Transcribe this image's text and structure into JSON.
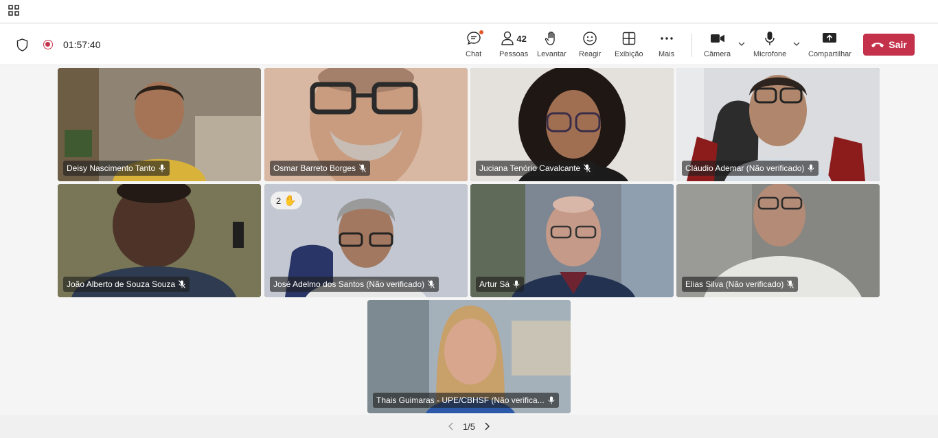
{
  "call": {
    "timer": "01:57:40"
  },
  "toolbar": {
    "chat": "Chat",
    "people": "Pessoas",
    "people_count": "42",
    "raise": "Levantar",
    "react": "Reagir",
    "view": "Exibição",
    "more": "Mais",
    "camera": "Câmera",
    "mic": "Microfone",
    "share": "Compartilhar",
    "leave": "Sair"
  },
  "participants": [
    {
      "name": "Deisy Nascimento Tanto",
      "bg": "#7a6a55"
    },
    {
      "name": "Osmar Barreto Borges",
      "bg": "#c8a792"
    },
    {
      "name": "Juciana Tenório Cavalcante",
      "bg": "#d9d4d0"
    },
    {
      "name": "Cláudio Ademar (Não verificado)",
      "bg": "#d6d8dc"
    },
    {
      "name": "João Alberto de Souza Souza",
      "bg": "#6e6a50"
    },
    {
      "name": "José Adelmo dos Santos (Não verificado)",
      "bg": "#b9bdc6",
      "hand_count": "2"
    },
    {
      "name": "Artur Sá",
      "bg": "#6f7a88"
    },
    {
      "name": "Elias Silva (Não verificado)",
      "bg": "#8a8a86"
    },
    {
      "name": "Thais Guimaras - UPE/CBHSF (Não verifica...",
      "bg": "#9aa7b2"
    }
  ],
  "pager": {
    "label": "1/5"
  }
}
